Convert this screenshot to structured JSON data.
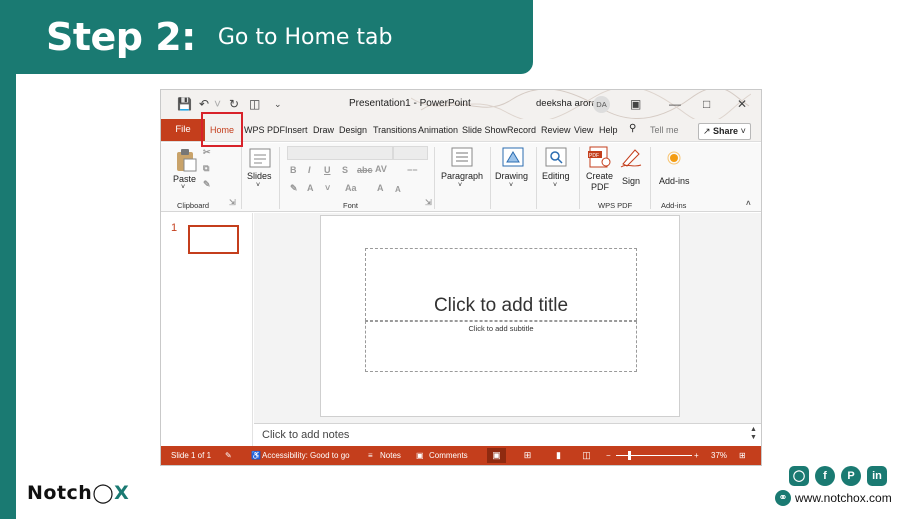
{
  "banner": {
    "step": "Step 2:",
    "instruction": "Go to Home tab"
  },
  "powerpoint": {
    "titlebar": {
      "title": "Presentation1  -  PowerPoint",
      "user": "deeksha arora",
      "avatar": "DA",
      "icons": [
        "save-icon",
        "undo-icon",
        "redo-icon",
        "present-icon",
        "customize-icon",
        "ribbon-display-icon",
        "minimize-icon",
        "maximize-icon",
        "close-icon"
      ]
    },
    "tabs": {
      "file": "File",
      "home": "Home",
      "wps_pdf": "WPS PDF",
      "insert": "Insert",
      "draw": "Draw",
      "design": "Design",
      "transitions": "Transitions",
      "animations": "Animation",
      "slideshow": "Slide Show",
      "record": "Record",
      "review": "Review",
      "view": "View",
      "help": "Help",
      "tellme": "Tell me",
      "share": "Share"
    },
    "ribbon": {
      "paste": "Paste",
      "slides": "Slides",
      "paragraph": "Paragraph",
      "drawing": "Drawing",
      "editing": "Editing",
      "create_pdf_line1": "Create",
      "create_pdf_line2": "PDF",
      "sign": "Sign",
      "addins": "Add-ins",
      "group_clipboard": "Clipboard",
      "group_font": "Font",
      "group_wps_pdf": "WPS PDF",
      "group_addins": "Add-ins"
    },
    "thumbnail_number": "1",
    "slide": {
      "title_placeholder": "Click to add title",
      "subtitle_placeholder": "Click to add subtitle"
    },
    "notes_placeholder": "Click to add notes",
    "status": {
      "slide_count": "Slide 1 of 1",
      "accessibility": "Accessibility: Good to go",
      "notes": "Notes",
      "comments": "Comments",
      "zoom": "37%"
    }
  },
  "branding": {
    "logo_left": "Notch",
    "logo_right": "X",
    "website": "www.notchox.com",
    "social_icons": [
      "instagram-icon",
      "facebook-icon",
      "pinterest-icon",
      "linkedin-icon"
    ]
  },
  "colors": {
    "teal": "#1a7a72",
    "powerpoint_red": "#c43e1c",
    "highlight_red": "#d8222a"
  }
}
